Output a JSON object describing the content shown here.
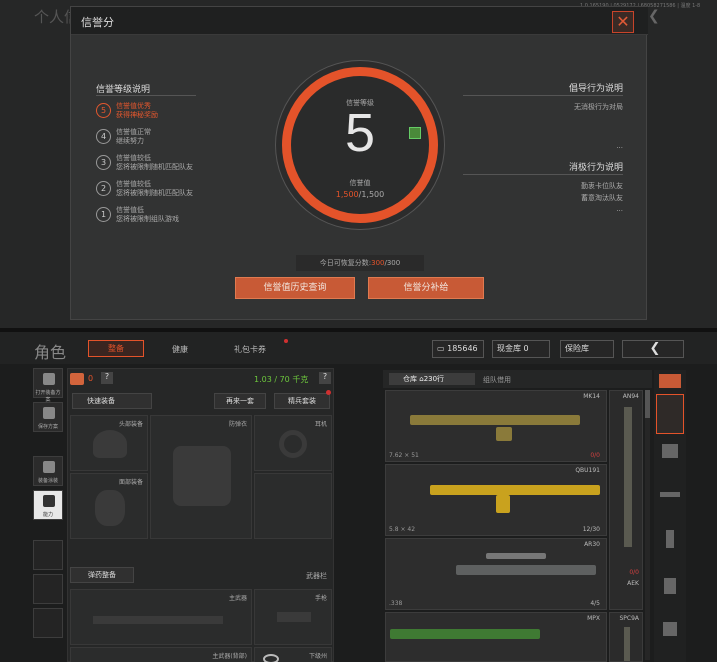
{
  "top": {
    "bg_title": "个人信",
    "version": "1.0.165190 | 0529172 | 68058271586 | 温度 1-8",
    "modal": {
      "title": "信誉分",
      "close_glyph": "✕",
      "left_title": "信誉等级说明",
      "levels": [
        {
          "num": "5",
          "line1": "信誉值优秀",
          "line2": "获得神秘奖励",
          "active": true
        },
        {
          "num": "4",
          "line1": "信誉值正常",
          "line2": "继续努力",
          "active": false
        },
        {
          "num": "3",
          "line1": "信誉值较低",
          "line2": "您将被限制随机匹配队友",
          "active": false
        },
        {
          "num": "2",
          "line1": "信誉值较低",
          "line2": "您将被限制随机匹配队友",
          "active": false
        },
        {
          "num": "1",
          "line1": "信誉值低",
          "line2": "您将被限制组队游戏",
          "active": false
        }
      ],
      "ring": {
        "level_label": "信誉等级",
        "level": "5",
        "value_label": "信誉值",
        "value_current": "1,500",
        "value_max": "/1,500"
      },
      "right_top": {
        "title": "倡导行为说明",
        "line": "无消极行为对局",
        "more": "..."
      },
      "right_bottom": {
        "title": "消极行为说明",
        "lines": [
          "勤衷卡位队友",
          "蓄意淘汰队友"
        ],
        "more": "..."
      },
      "restore": {
        "label": "今日可恢复分数:",
        "value": "300",
        "max": "/300"
      },
      "btn_history": "信誉值历史查询",
      "btn_supplement": "信誉分补给"
    }
  },
  "bottom": {
    "header": {
      "title": "角色",
      "tabs": [
        "整备",
        "健康",
        "礼包卡券"
      ],
      "money": "185646",
      "cash_vault": "现金库 0",
      "safe_vault": "保险库",
      "back_glyph": "❮"
    },
    "left_bar": [
      "打开装备方案",
      "保存方案",
      "装备涂装",
      "能力"
    ],
    "gear": {
      "count": "0",
      "help": "?",
      "weight": "1.03 / 70 千克",
      "quick_equip": "快速装备",
      "again": "再来一套",
      "elite": "精兵套装",
      "slots": [
        "头部装备",
        "防弹衣",
        "耳机",
        "面部装备"
      ],
      "ammo_equip": "弹药整备",
      "weapon_bar": "武器栏",
      "weapons": [
        "主武器",
        "手枪",
        "主武器(背部)",
        "近战武器"
      ],
      "melee_label": "下级州"
    },
    "warehouse": {
      "tab_main": "仓库",
      "capacity": "230行",
      "tab_team": "组队借用",
      "items": [
        {
          "name": "MK14",
          "caliber": "7.62 × 51",
          "count": "0/0"
        },
        {
          "name": "QBU191",
          "caliber": "5.8 × 42",
          "count": "12/30"
        },
        {
          "name": "AR30",
          "caliber": ".338",
          "count": "4/5"
        },
        {
          "name": "MPX",
          "caliber": "",
          "count": ""
        }
      ],
      "vertical_items": [
        {
          "name": "AN94",
          "count": "0/0"
        },
        {
          "name": "AEK",
          "count": ""
        },
        {
          "name": "SPC9A",
          "count": ""
        }
      ]
    }
  }
}
